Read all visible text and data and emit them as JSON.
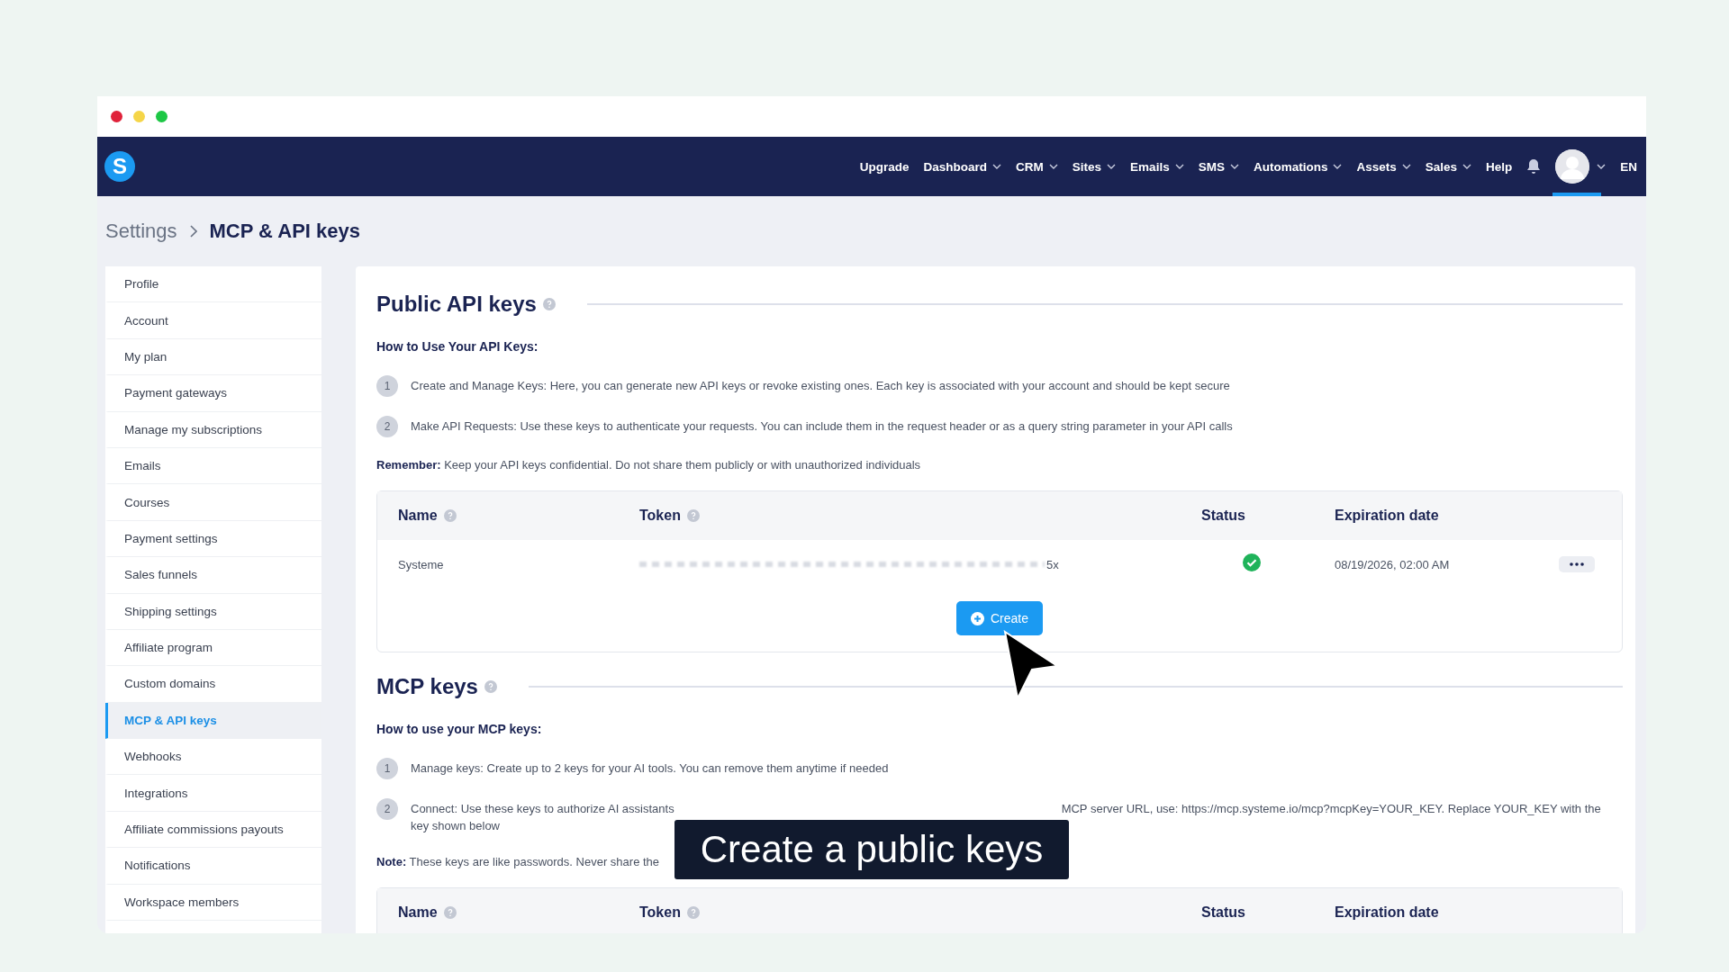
{
  "nav": {
    "logo": "S",
    "items": [
      {
        "label": "Upgrade",
        "dropdown": false
      },
      {
        "label": "Dashboard",
        "dropdown": true
      },
      {
        "label": "CRM",
        "dropdown": true
      },
      {
        "label": "Sites",
        "dropdown": true
      },
      {
        "label": "Emails",
        "dropdown": true
      },
      {
        "label": "SMS",
        "dropdown": true
      },
      {
        "label": "Automations",
        "dropdown": true
      },
      {
        "label": "Assets",
        "dropdown": true
      },
      {
        "label": "Sales",
        "dropdown": true
      },
      {
        "label": "Help",
        "dropdown": false
      }
    ],
    "avatar": {
      "selected": true,
      "dropdown": true
    },
    "language": "EN"
  },
  "breadcrumb": {
    "parent": "Settings",
    "current": "MCP & API keys"
  },
  "sidebar": {
    "items": [
      {
        "label": "Profile",
        "selected": false
      },
      {
        "label": "Account",
        "selected": false
      },
      {
        "label": "My plan",
        "selected": false
      },
      {
        "label": "Payment gateways",
        "selected": false
      },
      {
        "label": "Manage my subscriptions",
        "selected": false
      },
      {
        "label": "Emails",
        "selected": false
      },
      {
        "label": "Courses",
        "selected": false
      },
      {
        "label": "Payment settings",
        "selected": false
      },
      {
        "label": "Sales funnels",
        "selected": false
      },
      {
        "label": "Shipping settings",
        "selected": false
      },
      {
        "label": "Affiliate program",
        "selected": false
      },
      {
        "label": "Custom domains",
        "selected": false
      },
      {
        "label": "MCP & API keys",
        "selected": true
      },
      {
        "label": "Webhooks",
        "selected": false
      },
      {
        "label": "Integrations",
        "selected": false
      },
      {
        "label": "Affiliate commissions payouts",
        "selected": false
      },
      {
        "label": "Notifications",
        "selected": false
      },
      {
        "label": "Workspace members",
        "selected": false
      }
    ]
  },
  "sections": [
    {
      "title": "Public API keys",
      "subtitle": "How to Use Your API Keys:",
      "steps": [
        {
          "number": "1",
          "text": "Create and Manage Keys: Here, you can generate new API keys or revoke existing ones. Each key is associated with your account and should be kept secure"
        },
        {
          "number": "2",
          "text": "Make API Requests: Use these keys to authenticate your requests. You can include them in the request header or as a query string parameter in your API calls"
        }
      ],
      "note": "**Remember:** Keep your API keys confidential. Do not share them publicly or with unauthorized individuals",
      "table": {
        "columns": [
          {
            "label": "Name",
            "help": true
          },
          {
            "label": "Token",
            "help": true
          },
          {
            "label": "Status",
            "help": false
          },
          {
            "label": "Expiration date",
            "help": false
          }
        ],
        "rows": [
          {
            "name": "Systeme",
            "token_tail": "5x",
            "active": true,
            "expiration": "08/19/2026, 02:00 AM"
          }
        ],
        "create_button": "Create"
      }
    },
    {
      "title": "MCP keys",
      "subtitle": "How to use your MCP keys:",
      "steps": [
        {
          "number": "1",
          "text": "Manage keys: Create up to 2 keys for your AI tools. You can remove them anytime if needed"
        },
        {
          "number": "2",
          "text": "Connect: Use these keys to authorize AI assistants",
          "text_after_caption": "MCP server URL, use: https://mcp.systeme.io/mcp?mcpKey=YOUR_KEY. Replace YOUR_KEY with the",
          "text_next_line": "key shown below"
        }
      ],
      "note": "**Note:** These keys are like passwords. Never share the",
      "table": {
        "columns": [
          {
            "label": "Name",
            "help": true
          },
          {
            "label": "Token",
            "help": true
          },
          {
            "label": "Status",
            "help": false
          },
          {
            "label": "Expiration date",
            "help": false
          }
        ]
      }
    }
  ],
  "caption": "Create a public keys"
}
